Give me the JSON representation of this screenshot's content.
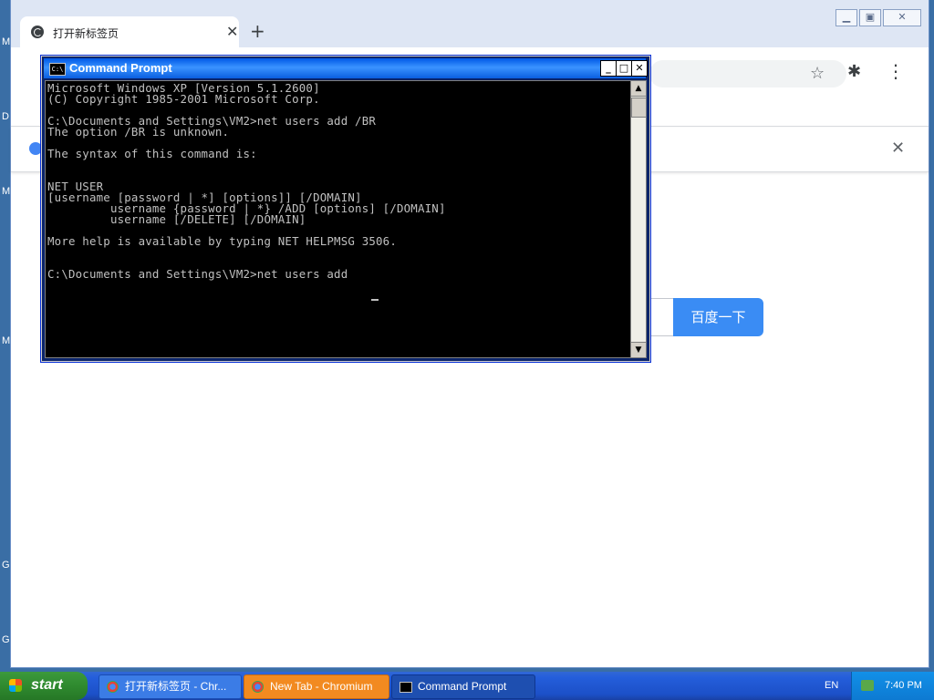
{
  "desktop": {
    "side_letters": [
      "M",
      "D",
      "M",
      "M",
      "G",
      "G"
    ]
  },
  "chromium": {
    "tab_title": "打开新标签页",
    "baidu_button": "百度一下",
    "new_tab_symbol": "+",
    "close_symbol": "✕"
  },
  "cmd": {
    "title": "Command Prompt",
    "lines": [
      "Microsoft Windows XP [Version 5.1.2600]",
      "(C) Copyright 1985-2001 Microsoft Corp.",
      "",
      "C:\\Documents and Settings\\VM2>net users add /BR",
      "The option /BR is unknown.",
      "",
      "The syntax of this command is:",
      "",
      "",
      "NET USER",
      "[username [password | *] [options]] [/DOMAIN]",
      "         username {password | *} /ADD [options] [/DOMAIN]",
      "         username [/DELETE] [/DOMAIN]",
      "",
      "More help is available by typing NET HELPMSG 3506.",
      "",
      "",
      "C:\\Documents and Settings\\VM2>net users add "
    ]
  },
  "taskbar": {
    "start_label": "start",
    "tasks": [
      {
        "label": "打开新标签页 - Chr..."
      },
      {
        "label": "New Tab - Chromium"
      },
      {
        "label": "Command Prompt"
      }
    ],
    "language": "EN",
    "clock": "7:40 PM"
  },
  "colors": {
    "xp_blue": "#245edb",
    "cmd_bg": "#000000",
    "cmd_text": "#c0c0c0",
    "baidu_blue": "#3a8cf4",
    "start_green": "#2f8a2f"
  }
}
